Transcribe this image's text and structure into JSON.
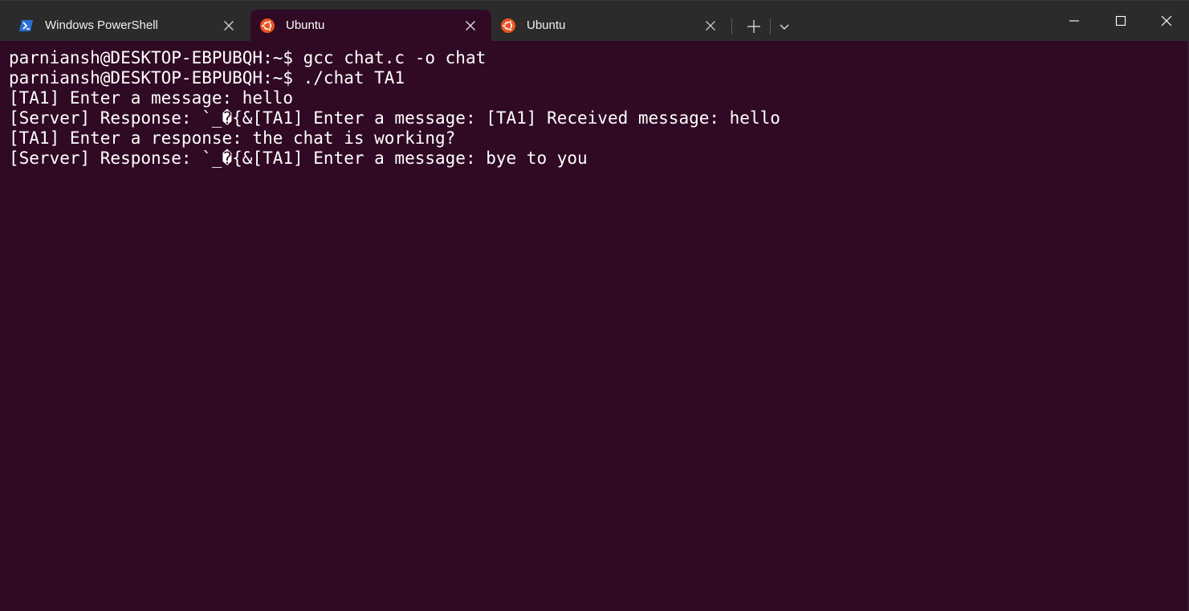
{
  "tabs": [
    {
      "label": "Windows PowerShell",
      "icon": "powershell-icon",
      "active": false
    },
    {
      "label": "Ubuntu",
      "icon": "ubuntu-icon",
      "active": true
    },
    {
      "label": "Ubuntu",
      "icon": "ubuntu-icon",
      "active": false
    }
  ],
  "toolbar": {
    "new_tab_icon": "plus-icon",
    "dropdown_icon": "chevron-down-icon"
  },
  "window_controls": {
    "minimize_icon": "minimize-icon",
    "maximize_icon": "maximize-icon",
    "close_icon": "close-icon"
  },
  "terminal": {
    "lines": [
      "parniansh@DESKTOP-EBPUBQH:~$ gcc chat.c -o chat",
      "parniansh@DESKTOP-EBPUBQH:~$ ./chat TA1",
      "[TA1] Enter a message: hello",
      "[Server] Response: `_�{&[TA1] Enter a message: [TA1] Received message: hello",
      "[TA1] Enter a response: the chat is working?",
      "[Server] Response: `_�{&[TA1] Enter a message: bye to you"
    ]
  },
  "colors": {
    "terminal_bg": "#300a24",
    "tabbar_bg": "#2b2b2b",
    "ubuntu_orange": "#e95420",
    "powershell_blue": "#2a6fd6",
    "text": "#ffffff"
  }
}
